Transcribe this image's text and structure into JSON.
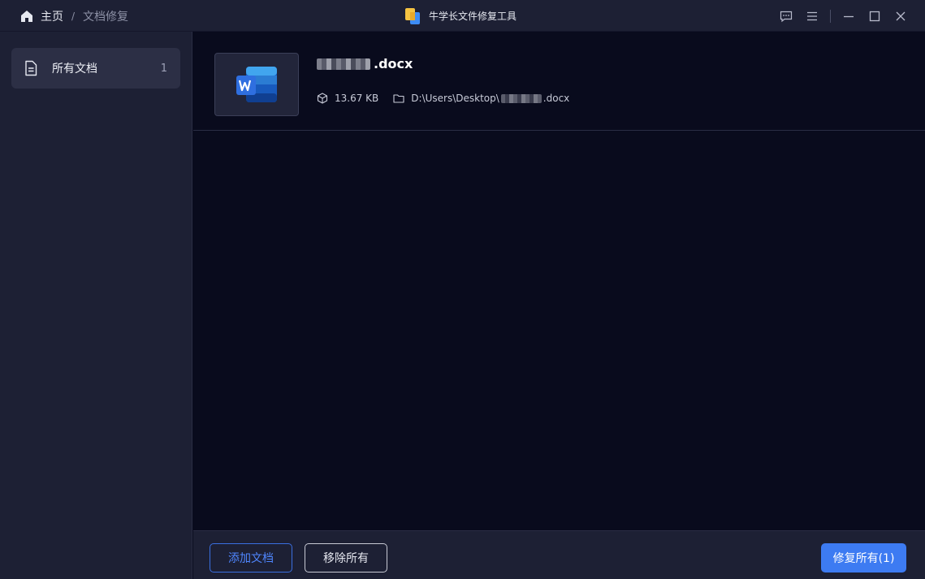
{
  "breadcrumb": {
    "home": "主页",
    "separator": "/",
    "current": "文档修复"
  },
  "app": {
    "title": "牛学长文件修复工具"
  },
  "sidebar": {
    "items": [
      {
        "label": "所有文档",
        "count": "1",
        "icon": "document-icon"
      }
    ]
  },
  "file": {
    "name_suffix": ".docx",
    "size": "13.67 KB",
    "path_prefix": "D:\\Users\\Desktop\\",
    "path_suffix": ".docx",
    "icon": "word-icon"
  },
  "footer": {
    "add_label": "添加文档",
    "remove_label": "移除所有",
    "repair_label": "修复所有(1)"
  },
  "colors": {
    "accent": "#3d7bf2",
    "background": "#090b1d",
    "panel": "#1d2034"
  }
}
